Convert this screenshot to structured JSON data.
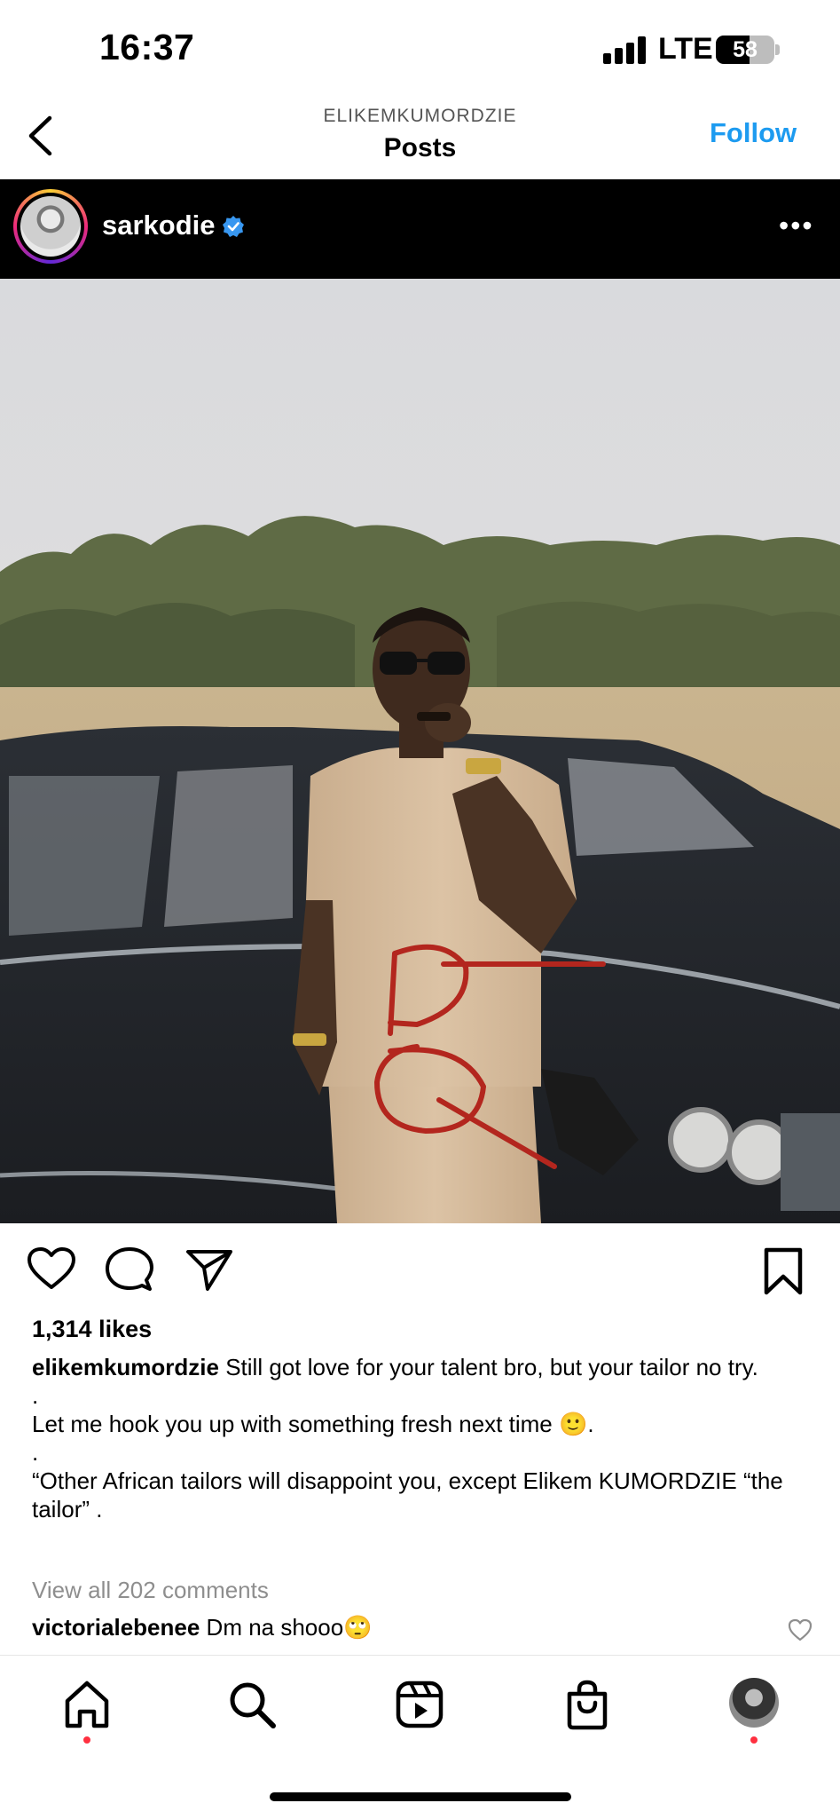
{
  "status_bar": {
    "time": "16:37",
    "network": "LTE",
    "battery": "58",
    "battery_level": 0.58
  },
  "nav": {
    "subtitle": "ELIKEMKUMORDZIE",
    "title": "Posts",
    "follow_label": "Follow",
    "back_icon": "chevron-left-icon"
  },
  "post": {
    "username": "sarkodie",
    "verified_icon": "verified-badge-icon",
    "more_icon": "more-horizontal-icon",
    "more_label": "•••",
    "likes": "1,314 likes",
    "caption": {
      "username": "elikemkumordzie",
      "text_line1": " Still got love for your talent bro, but your tailor no try.",
      "dot1": ".",
      "text_line2": "Let me hook you up with something fresh next time 🙂.",
      "dot2": ".",
      "text_line3": "“Other African tailors will disappoint you, except Elikem KUMORDZIE “the tailor” ."
    },
    "view_comments": "View all 202 comments",
    "top_comment": {
      "username": "victorialebenee",
      "text": " Dm na shooo🙄"
    }
  },
  "actions": [
    "heart-icon",
    "comment-icon",
    "send-icon",
    "bookmark-icon"
  ],
  "tab_bar": [
    "home-icon",
    "search-icon",
    "reels-icon",
    "shop-icon",
    "profile-avatar"
  ],
  "colors": {
    "accent": "#1d9bf0",
    "notification_dot": "#ff3040",
    "header_bg": "#000000",
    "annotation_red": "#b3261e"
  }
}
